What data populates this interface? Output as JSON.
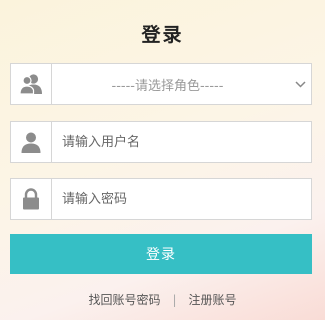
{
  "title": "登录",
  "role_select": {
    "selected": "-----请选择角色-----",
    "icon": "users-icon"
  },
  "username": {
    "placeholder": "请输入用户名",
    "value": "",
    "icon": "user-icon"
  },
  "password": {
    "placeholder": "请输入密码",
    "value": "",
    "icon": "lock-icon"
  },
  "login_button": "登录",
  "links": {
    "forgot": "找回账号密码",
    "separator": "|",
    "register": "注册账号"
  },
  "colors": {
    "accent": "#36bfc5",
    "icon": "#8c8c8c",
    "border": "#d6d6d6"
  }
}
